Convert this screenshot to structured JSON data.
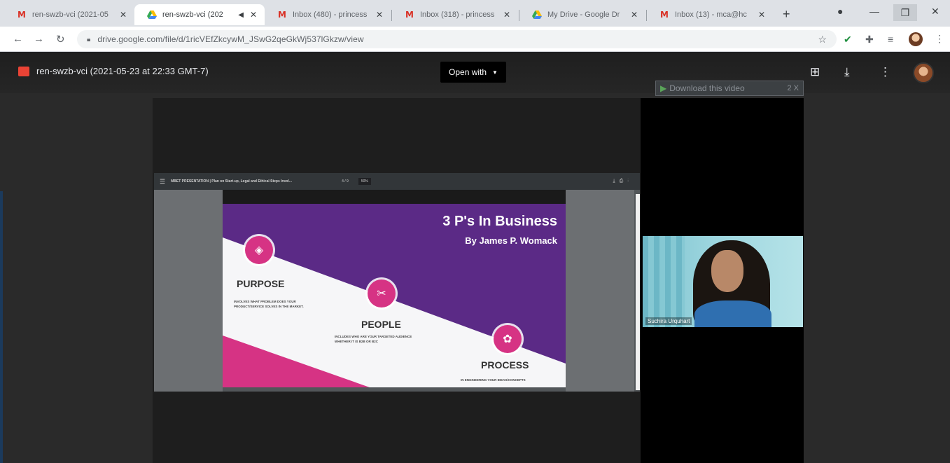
{
  "tabs": [
    {
      "title": "ren-swzb-vci (2021-05",
      "favicon": "gmail-icon",
      "active": false
    },
    {
      "title": "ren-swzb-vci (202",
      "favicon": "google-drive-icon",
      "active": true,
      "audio": true
    },
    {
      "title": "Inbox (480) - princess",
      "favicon": "gmail-icon",
      "active": false
    },
    {
      "title": "Inbox (318) - princess",
      "favicon": "gmail-icon",
      "active": false
    },
    {
      "title": "My Drive - Google Dr",
      "favicon": "google-drive-icon",
      "active": false
    },
    {
      "title": "Inbox (13) - mca@hc",
      "favicon": "gmail-icon",
      "active": false
    }
  ],
  "tab_close_glyph": "✕",
  "new_tab_glyph": "+",
  "address_bar": {
    "url": "drive.google.com/file/d/1ricVEfZkcywM_JSwG2qeGkWj537lGkzw/view"
  },
  "viewer": {
    "file_title": "ren-swzb-vci (2021-05-23 at 22:33 GMT-7)",
    "open_with_label": "Open with",
    "download_video_label": "Download this video",
    "download_video_count": "2",
    "download_video_close": "X"
  },
  "pdf": {
    "doc_title": "MBET PRESENTATION | Plan on Start-up, Legal and Ethical Steps Invol...",
    "page_indicator": "4 / 9",
    "zoom": "50%"
  },
  "slide": {
    "title": "3 P's In Business",
    "subtitle": "By James P. Womack",
    "items": [
      {
        "heading": "PURPOSE",
        "description": "INVOLVES WHAT PROBLEM DOES YOUR PRODUCT/SERVICE SOLVES IN THE MARKET."
      },
      {
        "heading": "PEOPLE",
        "description": "INCLUDES WHO ARE YOUR TARGETED AUDIENCE WHETHER IT IS B2B OR B2C"
      },
      {
        "heading": "PROCESS",
        "description": "IN ENGINEERING YOUR IDEAS/CONCEPTS"
      }
    ],
    "colors": {
      "purple": "#5b2a86",
      "magenta": "#d63384",
      "white": "#f6f6f8"
    }
  },
  "webcam": {
    "participant_name": "Suchira Urquhart"
  }
}
